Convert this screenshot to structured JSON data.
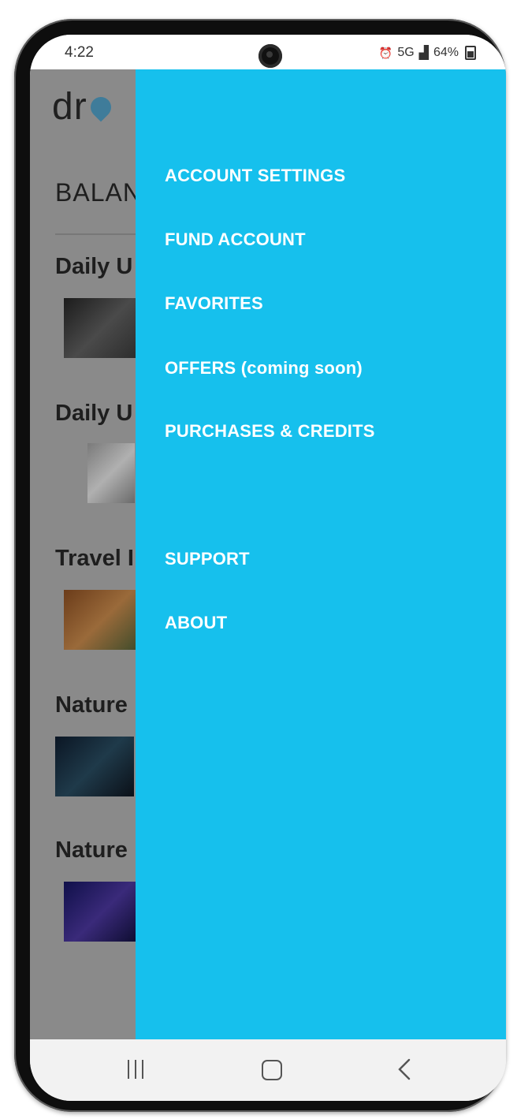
{
  "status_bar": {
    "time": "4:22",
    "network": "5G",
    "battery": "64%"
  },
  "app": {
    "logo_text": "dr",
    "balance_label": "BALAN",
    "sections": [
      {
        "title": "Daily U"
      },
      {
        "title": "Daily U"
      },
      {
        "title": "Travel I"
      },
      {
        "title": "Nature"
      },
      {
        "title": "Nature"
      }
    ]
  },
  "drawer": {
    "background": "#16c0ed",
    "items": [
      {
        "label": "ACCOUNT SETTINGS"
      },
      {
        "label": "FUND ACCOUNT"
      },
      {
        "label": "FAVORITES"
      },
      {
        "label": "OFFERS (coming soon)"
      },
      {
        "label": "PURCHASES & CREDITS"
      },
      {
        "label": "SUPPORT"
      },
      {
        "label": "ABOUT"
      }
    ]
  },
  "nav_bar": {
    "icons": [
      "recents-icon",
      "home-icon",
      "back-icon"
    ]
  }
}
